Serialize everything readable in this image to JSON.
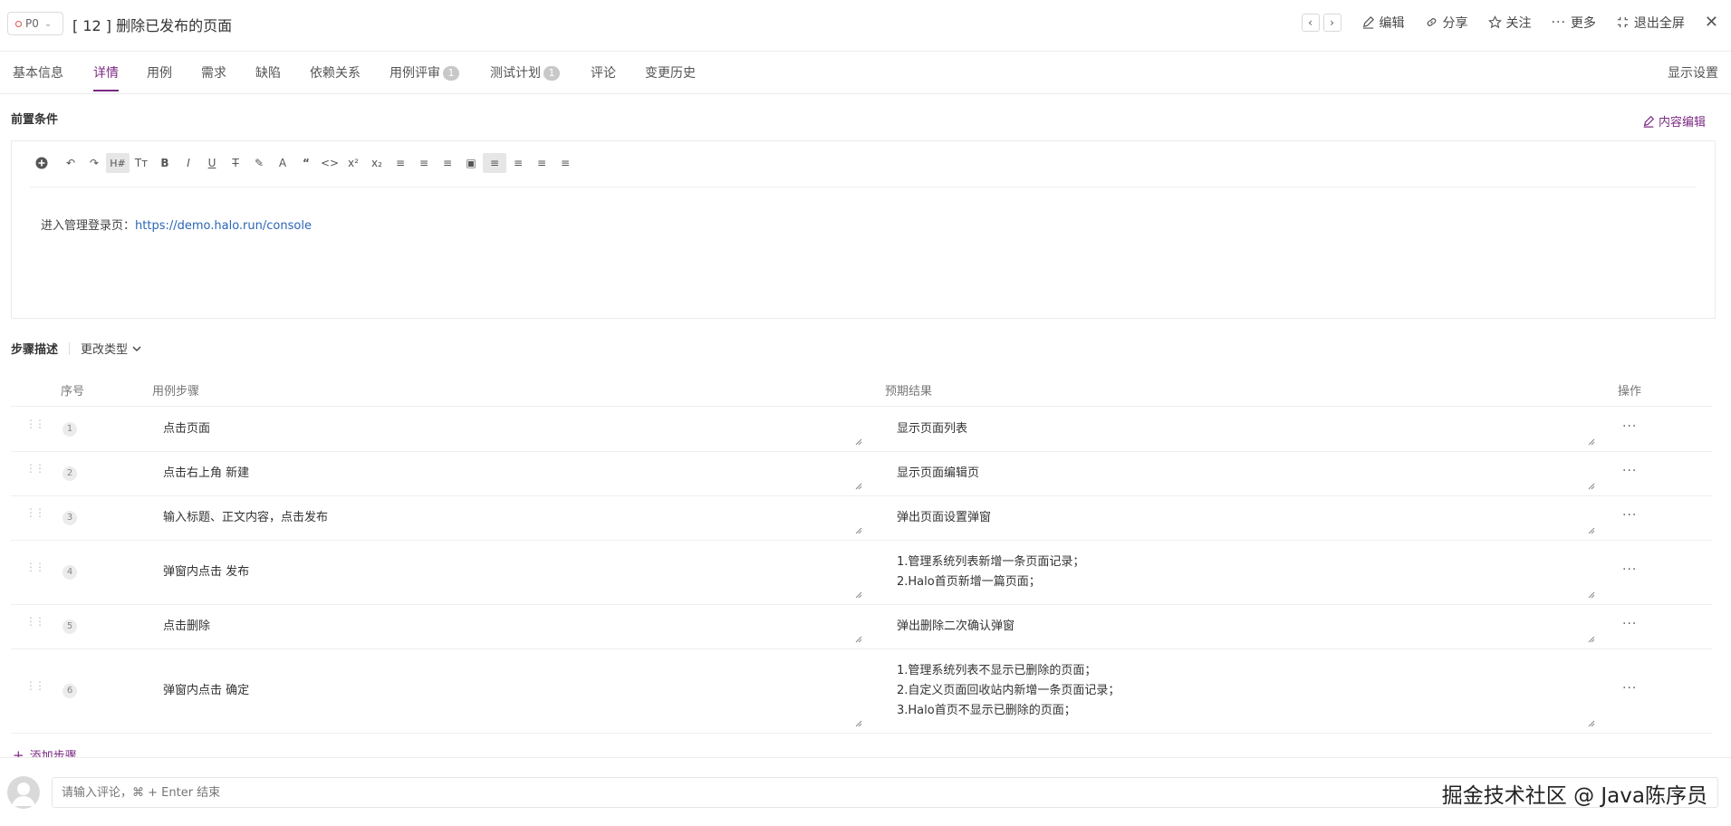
{
  "header": {
    "priority": "P0",
    "title": "[ 12 ]  删除已发布的页面",
    "actions": {
      "edit": "编辑",
      "share": "分享",
      "follow": "关注",
      "more": "更多",
      "exit_fullscreen": "退出全屏"
    }
  },
  "tabs": {
    "basic": "基本信息",
    "details": "详情",
    "cases": "用例",
    "requirements": "需求",
    "defects": "缺陷",
    "dependencies": "依赖关系",
    "case_review": "用例评审",
    "case_review_count": "1",
    "test_plan": "测试计划",
    "test_plan_count": "1",
    "comments": "评论",
    "history": "变更历史",
    "display_settings": "显示设置"
  },
  "precondition": {
    "title": "前置条件",
    "edit_label": "内容编辑",
    "text": "进入管理登录页：",
    "link": "https://demo.halo.run/console"
  },
  "steps": {
    "title": "步骤描述",
    "change_type": "更改类型",
    "columns": {
      "index": "序号",
      "step": "用例步骤",
      "expected": "预期结果",
      "action": "操作"
    },
    "rows": [
      {
        "index": "1",
        "step": "点击页面",
        "expected": "显示页面列表"
      },
      {
        "index": "2",
        "step": "点击右上角 新建",
        "expected": "显示页面编辑页"
      },
      {
        "index": "3",
        "step": "输入标题、正文内容，点击发布",
        "expected": "弹出页面设置弹窗"
      },
      {
        "index": "4",
        "step": "弹窗内点击 发布",
        "expected": "1.管理系统列表新增一条页面记录；\n2.Halo首页新增一篇页面；"
      },
      {
        "index": "5",
        "step": "点击删除",
        "expected": "弹出删除二次确认弹窗"
      },
      {
        "index": "6",
        "step": "弹窗内点击 确定",
        "expected": "1.管理系统列表不显示已删除的页面；\n2.自定义页面回收站内新增一条页面记录；\n3.Halo首页不显示已删除的页面；"
      }
    ],
    "add_step": "添加步骤"
  },
  "comment": {
    "placeholder": "请输入评论，⌘ + Enter 结束"
  },
  "watermark": "掘金技术社区 @ Java陈序员",
  "colors": {
    "accent": "#7b2a83",
    "link": "#2a66b8",
    "priority_dot": "#e0524d"
  }
}
